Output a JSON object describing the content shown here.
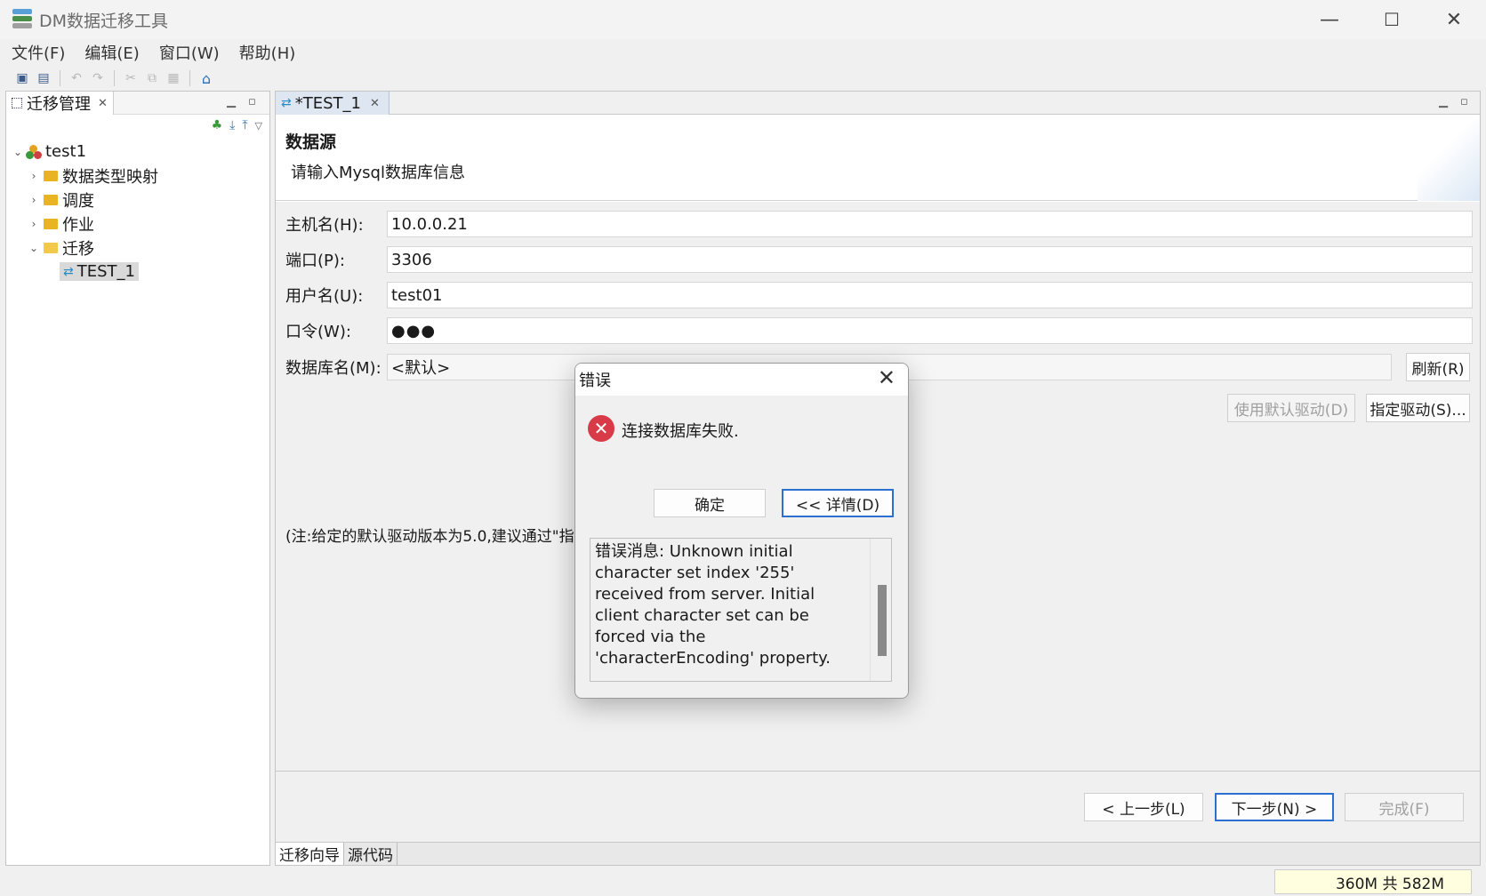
{
  "window": {
    "title": "DM数据迁移工具",
    "controls": {
      "minimize": "—",
      "maximize": "☐",
      "close": "✕"
    }
  },
  "menu": [
    "文件(F)",
    "编辑(E)",
    "窗口(W)",
    "帮助(H)"
  ],
  "left_panel": {
    "tab_label": "迁移管理",
    "tab_close": "✕",
    "tree": {
      "root": "test1",
      "items": [
        "数据类型映射",
        "调度",
        "作业",
        "迁移"
      ],
      "selected_child": "TEST_1"
    }
  },
  "editor": {
    "tab_label": "*TEST_1",
    "tab_close": "✕",
    "header_title": "数据源",
    "header_subtitle": "请输入Mysql数据库信息",
    "fields": {
      "host_label": "主机名(H):",
      "host_value": "10.0.0.21",
      "port_label": "端口(P):",
      "port_value": "3306",
      "user_label": "用户名(U):",
      "user_value": "test01",
      "password_label": "口令(W):",
      "password_value": "●●●",
      "db_label": "数据库名(M):",
      "db_value": "<默认>"
    },
    "buttons": {
      "refresh": "刷新(R)",
      "default_driver": "使用默认驱动(D)",
      "specify_driver": "指定驱动(S)...",
      "back": "< 上一步(L)",
      "next": "下一步(N) >",
      "finish": "完成(F)"
    },
    "note": "(注:给定的默认驱动版本为5.0,建议通过\"指",
    "bottom_tabs": [
      "迁移向导",
      "源代码"
    ]
  },
  "status": {
    "memory": "360M 共 582M"
  },
  "dialog": {
    "title": "错误",
    "close": "✕",
    "icon": "error-icon",
    "message": "连接数据库失败.",
    "ok_label": "确定",
    "details_label": "<< 详情(D)",
    "detail_text": "错误消息: Unknown initial character set index '255' received from server. Initial client character set can be forced via the 'characterEncoding' property."
  },
  "colors": {
    "accent": "#2b6fcf",
    "error": "#d83b47",
    "folder": "#e8b423",
    "tab_active": "#dde6f1"
  }
}
